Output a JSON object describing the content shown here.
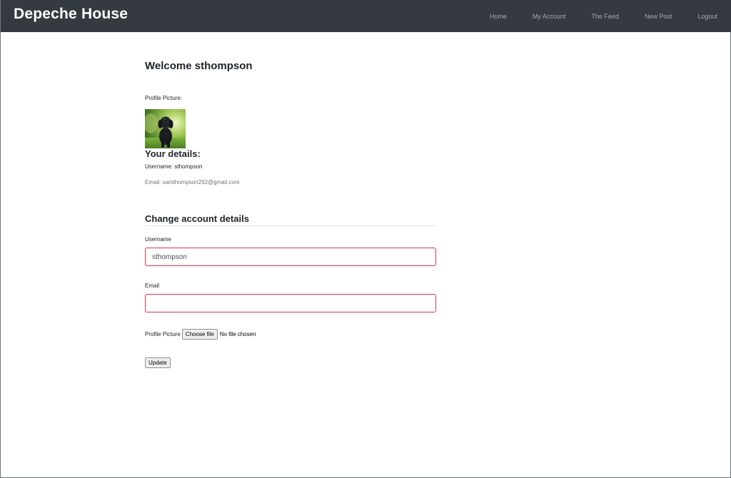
{
  "navbar": {
    "brand": "Depeche House",
    "links": [
      "Home",
      "My Account",
      "The Feed",
      "New Post",
      "Logout"
    ]
  },
  "welcome": "Welcome sthompson",
  "profile": {
    "picture_label": "Profile Picture:",
    "picture_icon": "black-puppy-photo"
  },
  "details": {
    "heading": "Your details:",
    "username_line": "Username: sthompson",
    "email_line": "Email: samthompson292@gmail.com"
  },
  "form": {
    "heading": "Change account details",
    "username_label": "Username",
    "username_value": "sthompson",
    "email_label": "Email",
    "email_value": "",
    "picture_label": "Profile Picture",
    "choose_file_label": "Choose file",
    "file_status": "No file chosen",
    "submit_label": "Update"
  },
  "colors": {
    "navbar_bg": "#343a40",
    "invalid_border": "#dc3545",
    "muted_text": "#6c757d"
  }
}
